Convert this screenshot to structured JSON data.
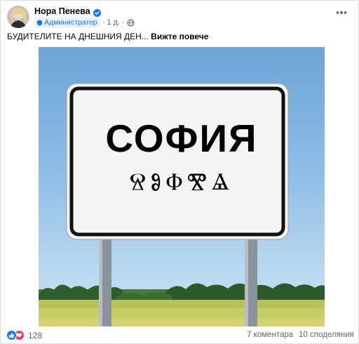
{
  "post": {
    "author": "Нора Пенева",
    "role_badge": "Администратор",
    "time": "1 д.",
    "separator": "·",
    "text": "БУДИТЕЛИТЕ НА ДНЕШНИЯ ДЕН...",
    "see_more": "Вижте повече"
  },
  "image": {
    "sign_city": "СОФИЯ",
    "sign_glagolitic": "ⰔⰑⰗⰊⰡ"
  },
  "footer": {
    "reaction_count": "128",
    "comments": "7 коментара",
    "shares": "10 споделяния"
  },
  "icons": {
    "verified": "verified-badge-icon",
    "admin": "admin-shield-icon",
    "globe": "globe-icon",
    "more": "more-options-icon",
    "like": "like-reaction-icon",
    "love": "love-reaction-icon"
  },
  "colors": {
    "accent": "#1877f2",
    "love": "#f33e58",
    "badge_bg": "#e7f3ff",
    "meta_text": "#65676b"
  }
}
